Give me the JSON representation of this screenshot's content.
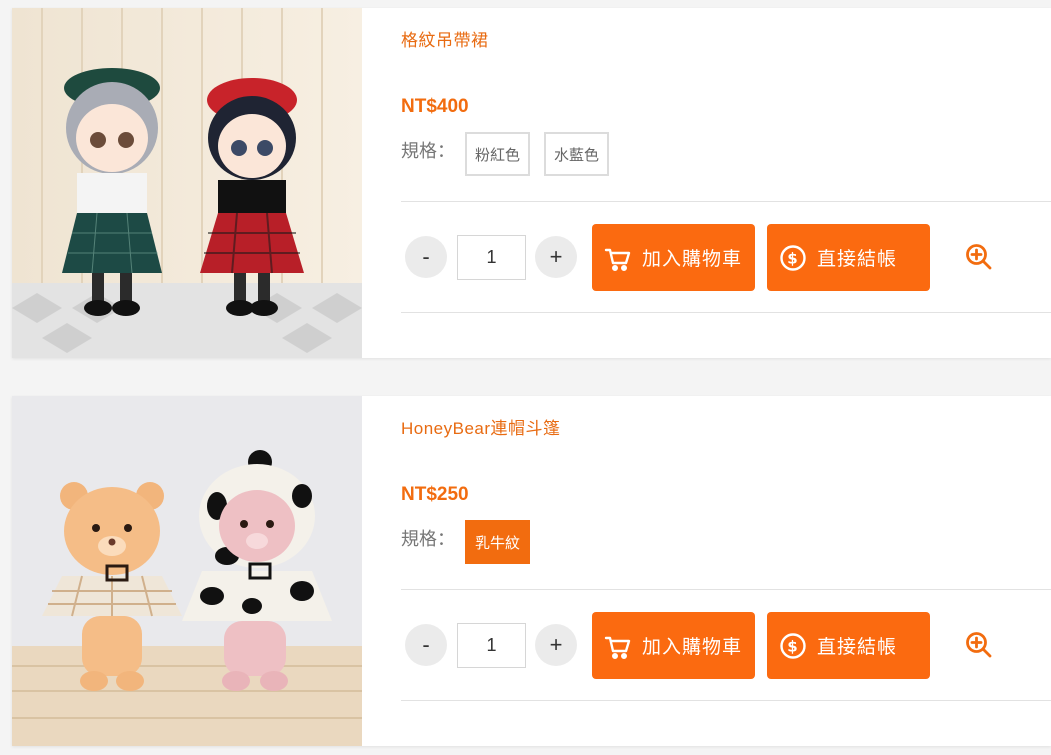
{
  "products": [
    {
      "name": "格紋吊帶裙",
      "price": "NT$400",
      "spec_label": "規格：",
      "options": [
        {
          "label": "粉紅色",
          "selected": false
        },
        {
          "label": "水藍色",
          "selected": false
        }
      ],
      "quantity": "1",
      "minus_label": "-",
      "plus_label": "+",
      "add_to_cart_label": "加入購物車",
      "checkout_label": "直接結帳",
      "image_icon": "doll-photo"
    },
    {
      "name": "HoneyBear連帽斗篷",
      "price": "NT$250",
      "spec_label": "規格：",
      "options": [
        {
          "label": "乳牛紋",
          "selected": true
        }
      ],
      "quantity": "1",
      "minus_label": "-",
      "plus_label": "+",
      "add_to_cart_label": "加入購物車",
      "checkout_label": "直接結帳",
      "image_icon": "bear-photo"
    }
  ],
  "colors": {
    "accent": "#fb6a10",
    "price": "#f26c0f",
    "name": "#e86b12"
  },
  "icons": {
    "cart": "cart-icon",
    "checkout": "dollar-circle-icon",
    "zoom": "zoom-in-icon"
  }
}
